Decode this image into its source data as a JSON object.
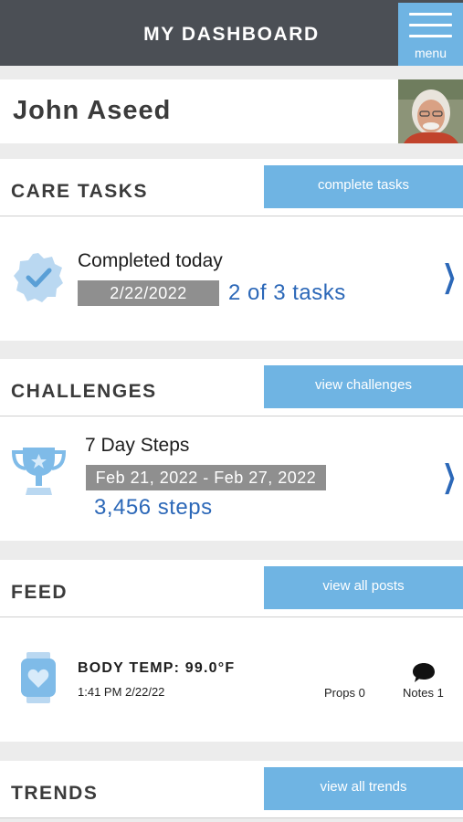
{
  "header": {
    "title": "MY DASHBOARD",
    "menu_label": "menu"
  },
  "user": {
    "name": "John Aseed"
  },
  "care_tasks": {
    "title": "CARE TASKS",
    "button": "complete tasks",
    "item_title": "Completed today",
    "date": "2/22/2022",
    "progress": "2 of 3 tasks"
  },
  "challenges": {
    "title": "CHALLENGES",
    "button": "view challenges",
    "item_title": "7 Day Steps",
    "date_range": "Feb 21, 2022 - Feb 27, 2022",
    "steps": "3,456 steps"
  },
  "feed": {
    "title": "FEED",
    "button": "view all posts",
    "post_title": "BODY TEMP: 99.0°F",
    "post_time": "1:41 PM 2/22/22",
    "props": "Props 0",
    "notes": "Notes 1"
  },
  "trends": {
    "title": "TRENDS",
    "button": "view all trends"
  },
  "icons": {
    "menu": "hamburger-icon",
    "care_tasks": "verified-badge-icon",
    "challenges": "trophy-icon",
    "feed": "smartwatch-heart-icon",
    "notes": "speech-bubble-icon",
    "chevron": "chevron-right-icon"
  },
  "colors": {
    "header_bg": "#4b4f55",
    "accent": "#6fb4e3",
    "value_blue": "#2c68b8",
    "badge_gray": "#8f8f8f"
  }
}
